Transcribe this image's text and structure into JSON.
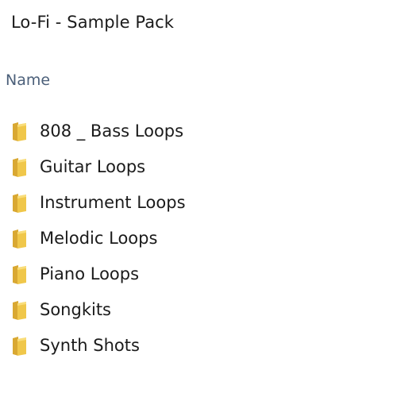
{
  "window": {
    "title": "Lo-Fi - Sample Pack"
  },
  "columns": {
    "name_header": "Name"
  },
  "theme": {
    "folder_color": "#f0c74a",
    "folder_dark": "#d9a832",
    "folder_light": "#f9dd7a",
    "header_color": "#4c607a",
    "text_color": "#1b1b1b"
  },
  "items": [
    {
      "label": "808 _ Bass Loops",
      "icon": "folder-icon"
    },
    {
      "label": "Guitar Loops",
      "icon": "folder-icon"
    },
    {
      "label": "Instrument Loops",
      "icon": "folder-icon"
    },
    {
      "label": "Melodic Loops",
      "icon": "folder-icon"
    },
    {
      "label": "Piano Loops",
      "icon": "folder-icon"
    },
    {
      "label": "Songkits",
      "icon": "folder-icon"
    },
    {
      "label": "Synth Shots",
      "icon": "folder-icon"
    }
  ]
}
